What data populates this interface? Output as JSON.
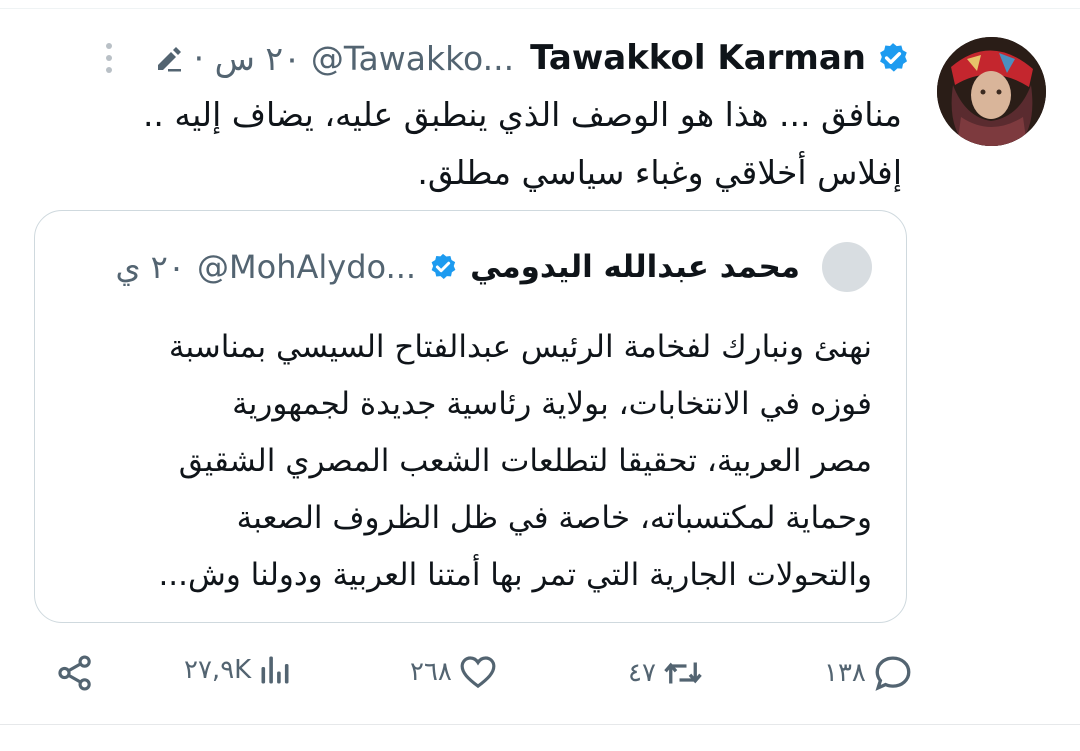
{
  "tweet": {
    "author_name": "Tawakkol Karman",
    "handle": "@Tawakko...",
    "timestamp": "٢٠ س ·",
    "text_line1": "منافق ... هذا هو الوصف الذي ينطبق عليه، يضاف إليه ..",
    "text_line2": "إفلاس أخلاقي وغباء سياسي مطلق."
  },
  "quote": {
    "author_name": "محمد عبدالله اليدومي",
    "handle": "@MohAlydo...",
    "timestamp": "٢٠ ي",
    "lines": [
      "نهنئ ونبارك لفخامة الرئيس عبدالفتاح السيسي بمناسبة",
      "فوزه في الانتخابات، بولاية رئاسية جديدة لجمهورية",
      "مصر العربية، تحقيقا لتطلعات الشعب المصري الشقيق",
      "وحماية لمكتسباته، خاصة في ظل الظروف الصعبة",
      "والتحولات الجارية التي تمر بها أمتنا العربية ودولنا وش..."
    ]
  },
  "actions": {
    "replies": "١٣٨",
    "retweets": "٤٧",
    "likes": "٢٦٨",
    "views": "٢٧,٩K"
  },
  "colors": {
    "verified": "#1d9bf0",
    "secondary_text": "#536471",
    "border": "#cfd9de"
  },
  "icons": [
    "more-icon",
    "edit-icon",
    "verified-badge-icon",
    "reply-icon",
    "retweet-icon",
    "like-icon",
    "views-icon",
    "share-icon"
  ]
}
